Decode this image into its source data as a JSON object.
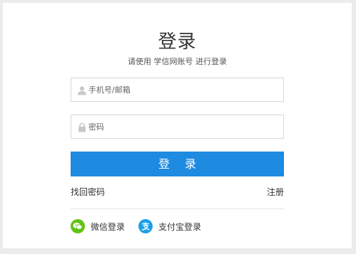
{
  "title": "登录",
  "subtitle": "请使用 学信网账号 进行登录",
  "fields": {
    "phone_placeholder": "手机号/邮箱",
    "password_placeholder": "密码"
  },
  "login_button": "登 录",
  "links": {
    "forgot_password": "找回密码",
    "register": "注册"
  },
  "social": {
    "wechat_label": "微信登录",
    "alipay_label": "支付宝登录"
  },
  "colors": {
    "primary": "#1e8ae0",
    "wechat": "#5fc314",
    "alipay": "#1aa0e8"
  },
  "icons": {
    "user": "user-icon",
    "lock": "lock-icon",
    "wechat": "wechat-icon",
    "alipay": "alipay-icon"
  }
}
